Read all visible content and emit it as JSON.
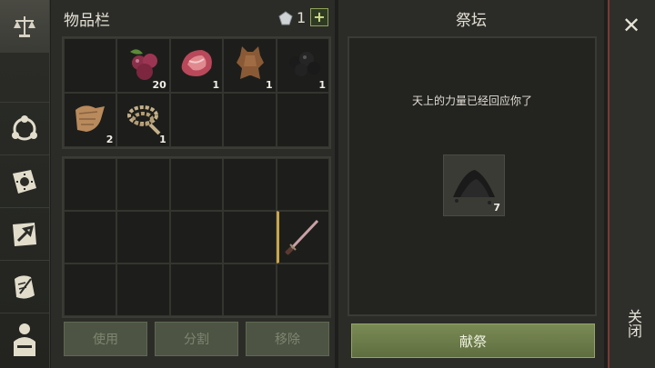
{
  "inventory": {
    "title": "物品栏",
    "currency_count": "1",
    "plus_label": "+",
    "items": [
      {
        "name": "berries",
        "count": "20"
      },
      {
        "name": "raw-meat",
        "count": "1"
      },
      {
        "name": "leather-hide",
        "count": "1"
      },
      {
        "name": "coal",
        "count": "1"
      },
      {
        "name": "cloth",
        "count": "2"
      },
      {
        "name": "rope",
        "count": "1"
      }
    ],
    "equipped_weapon": "sword",
    "buttons": {
      "use": "使用",
      "split": "分割",
      "remove": "移除"
    }
  },
  "altar": {
    "title": "祭坛",
    "message": "天上的力量已经回应你了",
    "offering_count": "7",
    "offer_button": "献祭"
  },
  "close": {
    "label": "关闭"
  },
  "colors": {
    "accent_green": "#6f7f48",
    "close_border": "#7a3a32"
  }
}
